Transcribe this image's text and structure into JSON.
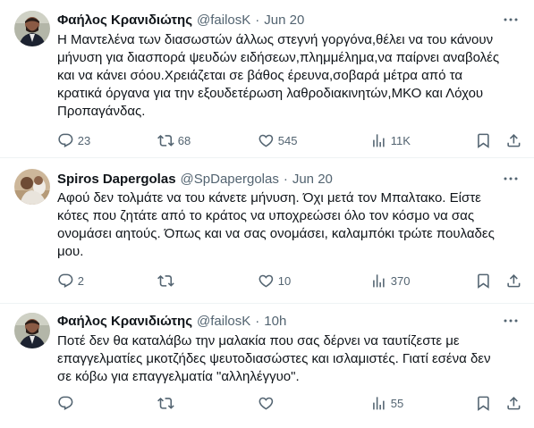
{
  "tweets": [
    {
      "name": "Φαήλος Κρανιδιώτης",
      "handle": "@failosK",
      "time": "Jun 20",
      "text": "Η Μαντελένα των διασωστών άλλως στεγνή γοργόνα,θέλει να του κάνουν\nμήνυση για διασπορά ψευδών ειδήσεων,πλημμέλημα,να παίρνει αναβολές\nκαι να κάνει σόου.Χρειάζεται σε βάθος έρευνα,σοβαρά μέτρα από τα\nκρατικά όργανα για την εξουδετέρωση λαθροδιακινητών,ΜΚΟ και Λόχου\nΠροπαγάνδας.",
      "replies": "23",
      "retweets": "68",
      "likes": "545",
      "views": "11K"
    },
    {
      "name": "Spiros Dapergolas",
      "handle": "@SpDapergolas",
      "time": "Jun 20",
      "text": "Αφού δεν τολμάτε να του κάνετε μήνυση. Όχι μετά τον Μπαλτακο. Είστε\nκότες που ζητάτε από το κράτος να υποχρεώσει όλο τον κόσμο να σας\nονομάσει αητούς. Όπως και να σας ονομάσει, καλαμπόκι τρώτε πουλαδες\nμου.",
      "replies": "2",
      "retweets": "",
      "likes": "10",
      "views": "370"
    },
    {
      "name": "Φαήλος Κρανιδιώτης",
      "handle": "@failosK",
      "time": "10h",
      "text": "Ποτέ δεν θα καταλάβω την μαλακία που σας δέρνει να ταυτίζεστε με\nεπαγγελματίες μκοτζήδες ψευτοδιασώστες και ισλαμιστές. Γιατί εσένα δεν\nσε κόβω για επαγγελματία \"αλληλέγγυο\".",
      "replies": "",
      "retweets": "",
      "likes": "",
      "views": "55"
    }
  ],
  "icons": {
    "more": "more-dots-icon",
    "reply": "reply-icon",
    "retweet": "retweet-icon",
    "like": "heart-icon",
    "views": "views-bar-icon",
    "bookmark": "bookmark-icon",
    "share": "share-icon"
  },
  "colors": {
    "text": "#0f1419",
    "secondary": "#536471",
    "divider": "#eff3f4"
  }
}
